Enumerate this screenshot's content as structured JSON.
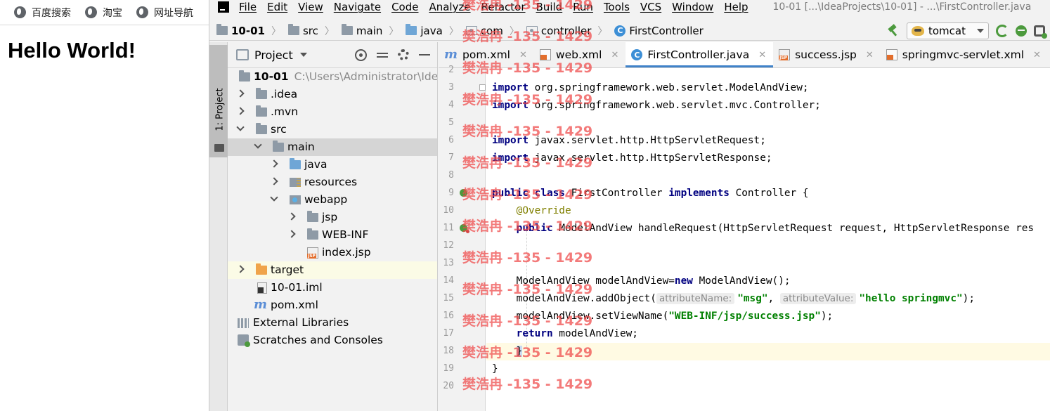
{
  "browser": {
    "bookmarks": [
      {
        "icon": "globe-icon",
        "label": "百度搜索"
      },
      {
        "icon": "globe-icon",
        "label": "淘宝"
      },
      {
        "icon": "globe-icon",
        "label": "网址导航"
      }
    ],
    "page_heading": "Hello World!"
  },
  "ide": {
    "menu": [
      "File",
      "Edit",
      "View",
      "Navigate",
      "Code",
      "Analyze",
      "Refactor",
      "Build",
      "Run",
      "Tools",
      "VCS",
      "Window",
      "Help"
    ],
    "window_title": "10-01 [...\\IdeaProjects\\10-01] - ...\\FirstController.java",
    "breadcrumbs": [
      "10-01",
      "src",
      "main",
      "java",
      "com",
      "controller",
      "FirstController"
    ],
    "run_config": "tomcat",
    "side_tab": "1: Project",
    "project_panel": {
      "title": "Project",
      "tree": [
        {
          "label": "10-01",
          "extra": "C:\\Users\\Administrator\\IdeaP"
        },
        {
          "label": ".idea"
        },
        {
          "label": ".mvn"
        },
        {
          "label": "src"
        },
        {
          "label": "main"
        },
        {
          "label": "java"
        },
        {
          "label": "resources"
        },
        {
          "label": "webapp"
        },
        {
          "label": "jsp"
        },
        {
          "label": "WEB-INF"
        },
        {
          "label": "index.jsp"
        },
        {
          "label": "target"
        },
        {
          "label": "10-01.iml"
        },
        {
          "label": "pom.xml"
        },
        {
          "label": "External Libraries"
        },
        {
          "label": "Scratches and Consoles"
        }
      ]
    },
    "tabs": [
      {
        "label": "pom.xml"
      },
      {
        "label": "web.xml"
      },
      {
        "label": "FirstController.java"
      },
      {
        "label": "success.jsp"
      },
      {
        "label": "springmvc-servlet.xml"
      }
    ],
    "line_numbers": [
      "2",
      "3",
      "4",
      "5",
      "6",
      "7",
      "8",
      "9",
      "10",
      "11",
      "12",
      "13",
      "14",
      "15",
      "16",
      "17",
      "18",
      "19",
      "20"
    ],
    "code": {
      "l3_kw": "import",
      "l3": " org.springframework.web.servlet.ModelAndView;",
      "l4_kw": "import",
      "l4": " org.springframework.web.servlet.mvc.Controller;",
      "l6_kw": "import",
      "l6": " javax.servlet.http.HttpServletRequest;",
      "l7_kw": "import",
      "l7": " javax.servlet.http.HttpServletResponse;",
      "l9_kw1": "public class",
      "l9_a": " FirstController ",
      "l9_kw2": "implements",
      "l9_b": " Controller {",
      "l10_ann": "@Override",
      "l11_kw": "public",
      "l11": " ModelAndView handleRequest(HttpServletRequest request, HttpServletResponse res",
      "l14_a": "ModelAndView modelAndView=",
      "l14_kw": "new",
      "l14_b": " ModelAndView();",
      "l15_a": "modelAndView.addObject(",
      "l15_hint1": "attributeName:",
      "l15_s1": "\"msg\"",
      "l15_b": ", ",
      "l15_hint2": "attributeValue:",
      "l15_s2": "\"hello springmvc\"",
      "l15_c": ");",
      "l16_a": "modelAndView.setViewName(",
      "l16_s": "\"WEB-INF/jsp/success.jsp\"",
      "l16_b": ");",
      "l17_kw": "return",
      "l17": " modelAndView;",
      "l18": "}",
      "l19": "}"
    },
    "watermark": "樊浩冉 -135 - 1429"
  }
}
